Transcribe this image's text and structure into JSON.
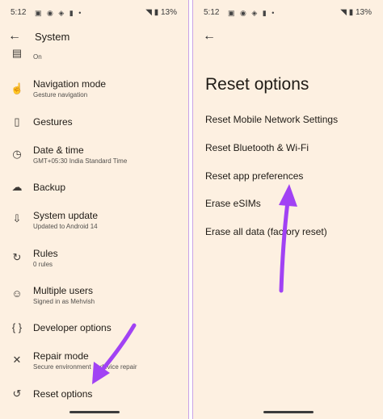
{
  "left": {
    "status": {
      "time": "5:12",
      "battery": "13%"
    },
    "app_bar": {
      "title": "System"
    },
    "items": [
      {
        "title": "",
        "subtitle": "On"
      },
      {
        "title": "Navigation mode",
        "subtitle": "Gesture navigation"
      },
      {
        "title": "Gestures",
        "subtitle": ""
      },
      {
        "title": "Date & time",
        "subtitle": "GMT+05:30 India Standard Time"
      },
      {
        "title": "Backup",
        "subtitle": ""
      },
      {
        "title": "System update",
        "subtitle": "Updated to Android 14"
      },
      {
        "title": "Rules",
        "subtitle": "0 rules"
      },
      {
        "title": "Multiple users",
        "subtitle": "Signed in as Mehvish"
      },
      {
        "title": "Developer options",
        "subtitle": ""
      },
      {
        "title": "Repair mode",
        "subtitle": "Secure environment ... device repair"
      },
      {
        "title": "Reset options",
        "subtitle": ""
      }
    ]
  },
  "right": {
    "status": {
      "time": "5:12",
      "battery": "13%"
    },
    "title": "Reset options",
    "options": [
      "Reset Mobile Network Settings",
      "Reset Bluetooth & Wi-Fi",
      "Reset app preferences",
      "Erase eSIMs",
      "Erase all data (factory reset)"
    ]
  },
  "colors": {
    "background": "#fdf0e1",
    "arrow": "#a142f4",
    "divider": "#c9a2e6"
  }
}
